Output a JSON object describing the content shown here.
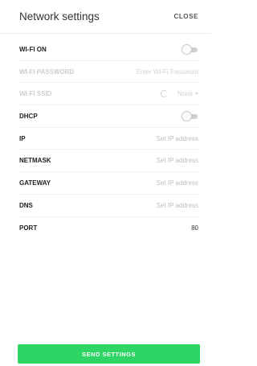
{
  "header": {
    "title": "Network settings",
    "close_label": "CLOSE"
  },
  "rows": {
    "wifi_on": {
      "label": "WI-FI ON",
      "state": "off"
    },
    "wifi_password": {
      "label": "WI-FI PASSWORD",
      "placeholder": "Enter Wi-Fi Password"
    },
    "wifi_ssid": {
      "label": "WI-FI SSID",
      "selected": "None",
      "refresh_icon": "refresh-icon",
      "caret_icon": "chevron-down-icon"
    },
    "dhcp": {
      "label": "DHCP",
      "state": "off"
    },
    "ip": {
      "label": "IP",
      "placeholder": "Set IP address"
    },
    "netmask": {
      "label": "NETMASK",
      "placeholder": "Set IP address"
    },
    "gateway": {
      "label": "GATEWAY",
      "placeholder": "Set IP address"
    },
    "dns": {
      "label": "DNS",
      "placeholder": "Set IP address"
    },
    "port": {
      "label": "PORT",
      "value": "80"
    }
  },
  "footer": {
    "send_label": "SEND SETTINGS"
  },
  "colors": {
    "accent": "#2ed464",
    "disabled_text": "#d2d2d2",
    "placeholder": "#9e9e9e"
  }
}
